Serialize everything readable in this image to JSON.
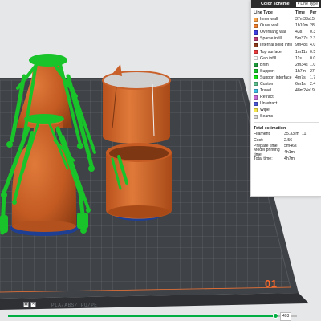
{
  "colors": {
    "support": "#19c42a",
    "body": "#c9602a",
    "plate": "#3f4246",
    "plate_number": "#ff6a2a",
    "slider_accent": "#00ae42"
  },
  "legend": {
    "title": "Color scheme",
    "dropdown_value": "Line Type",
    "columns": {
      "type": "Line Type",
      "time": "Time",
      "pct": "Per"
    },
    "rows": [
      {
        "name": "Inner wall",
        "time": "37m33s",
        "pct": "15.",
        "color": "#f8a24a"
      },
      {
        "name": "Outer wall",
        "time": "1h10m",
        "pct": "28.",
        "color": "#f0812e"
      },
      {
        "name": "Overhang wall",
        "time": "43s",
        "pct": "0.3",
        "color": "#3d3de0"
      },
      {
        "name": "Sparse infill",
        "time": "5m37s",
        "pct": "2.3",
        "color": "#b93b73"
      },
      {
        "name": "Internal solid infill",
        "time": "9m48s",
        "pct": "4.0",
        "color": "#8b3d1d"
      },
      {
        "name": "Top surface",
        "time": "1m11s",
        "pct": "0.5",
        "color": "#ee3d3d"
      },
      {
        "name": "Gap infill",
        "time": "11s",
        "pct": "0.0",
        "color": "#ffffff"
      },
      {
        "name": "Brim",
        "time": "2m34s",
        "pct": "1.0",
        "color": "#1e9b3a"
      },
      {
        "name": "Support",
        "time": "1h7m",
        "pct": "27.",
        "color": "#19c42a"
      },
      {
        "name": "Support interface",
        "time": "4m7s",
        "pct": "1.7",
        "color": "#12e012"
      },
      {
        "name": "Custom",
        "time": "6m1s",
        "pct": "2.4",
        "color": "#5ec08e"
      },
      {
        "name": "Travel",
        "time": "48m24s",
        "pct": "19.",
        "color": "#3fbfe6"
      }
    ],
    "extras": [
      {
        "name": "Retract",
        "color": "#c86bd6"
      },
      {
        "name": "Unretract",
        "color": "#4b58d6"
      },
      {
        "name": "Wipe",
        "color": "#f3e64a"
      },
      {
        "name": "Seams",
        "color": "#d8d8d8"
      }
    ],
    "estimation": {
      "title": "Total estimation",
      "rows": [
        {
          "key": "Filament:",
          "value": "35.33 m",
          "extra": "11"
        },
        {
          "key": "Cost:",
          "value": "2.56",
          "extra": ""
        },
        {
          "key": "Prepare time:",
          "value": "5m46s",
          "extra": ""
        },
        {
          "key": "Model printing time:",
          "value": "4h1m",
          "extra": ""
        },
        {
          "key": "Total time:",
          "value": "4h7m",
          "extra": ""
        }
      ]
    }
  },
  "plate": {
    "number": "01",
    "label": "PLA/ABS/TPU/PE"
  },
  "slider": {
    "value": "493",
    "progress": 0.92
  }
}
